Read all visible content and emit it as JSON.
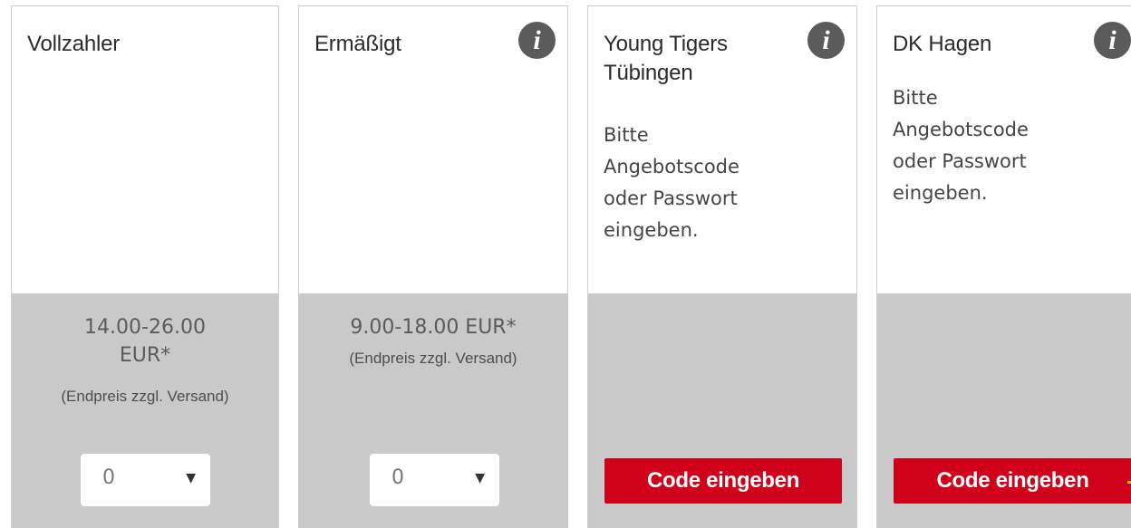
{
  "cards": [
    {
      "title": "Vollzahler",
      "price": "14.00-26.00\nEUR*",
      "price_note": "(Endpreis zzgl. Versand)",
      "quantity": "0"
    },
    {
      "title": "Ermäßigt",
      "price": "9.00-18.00 EUR*",
      "price_note": "(Endpreis zzgl. Versand)",
      "quantity": "0"
    },
    {
      "title": "Young Tigers\nTübingen",
      "note": "Bitte\nAngebotscode\noder Passwort\neingeben.",
      "button_label": "Code eingeben"
    },
    {
      "title": "DK Hagen",
      "note": "Bitte\nAngebotscode\noder Passwort\neingeben.",
      "button_label": "Code eingeben"
    }
  ],
  "icons": {
    "info": "info-icon",
    "dropdown": "chevron-down-icon",
    "info_glyph": "i",
    "dropdown_glyph": "▼"
  },
  "colors": {
    "accent_red": "#d0021b",
    "panel_gray": "#c9c9c9",
    "info_icon_bg": "#5b5b5b"
  }
}
